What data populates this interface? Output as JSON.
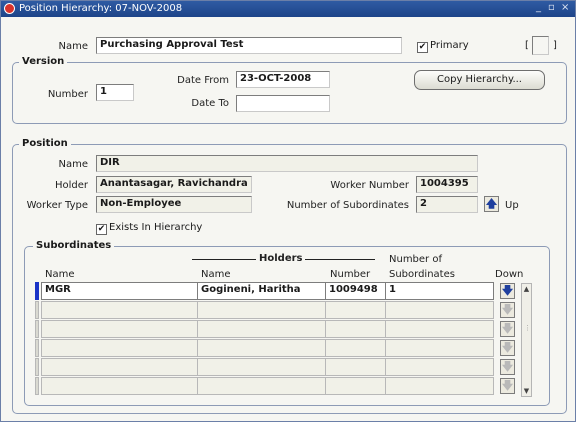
{
  "window": {
    "title": "Position Hierarchy: 07-NOV-2008",
    "controls": {
      "minimize": "_",
      "restore": "▫",
      "close": "×"
    }
  },
  "header": {
    "name_label": "Name",
    "name_value": "Purchasing Approval Test",
    "primary_label": "Primary",
    "primary_checked": true,
    "bracket_left": "[",
    "bracket_right": "]"
  },
  "version": {
    "title": "Version",
    "number_label": "Number",
    "number_value": "1",
    "date_from_label": "Date From",
    "date_from_value": "23-OCT-2008",
    "date_to_label": "Date To",
    "date_to_value": "",
    "copy_button_label": "Copy Hierarchy..."
  },
  "position": {
    "title": "Position",
    "name_label": "Name",
    "name_value": "DIR",
    "holder_label": "Holder",
    "holder_value": "Anantasagar, Ravichandra R",
    "worker_number_label": "Worker Number",
    "worker_number_value": "1004395",
    "worker_type_label": "Worker Type",
    "worker_type_value": "Non-Employee",
    "subordinates_count_label": "Number of Subordinates",
    "subordinates_count_value": "2",
    "up_label": "Up",
    "exists_label": "Exists In Hierarchy",
    "exists_checked": true
  },
  "subordinates": {
    "title": "Subordinates",
    "holders_group_label": "Holders",
    "columns": {
      "name": "Name",
      "holder_name": "Name",
      "number": "Number",
      "subordinates_line1": "Number of",
      "subordinates_line2": "Subordinates",
      "down": "Down"
    },
    "rows": [
      {
        "name": "MGR",
        "holder": "Gogineni, Haritha",
        "number": "1009498",
        "subordinates": "1"
      },
      {
        "name": "",
        "holder": "",
        "number": "",
        "subordinates": ""
      },
      {
        "name": "",
        "holder": "",
        "number": "",
        "subordinates": ""
      },
      {
        "name": "",
        "holder": "",
        "number": "",
        "subordinates": ""
      },
      {
        "name": "",
        "holder": "",
        "number": "",
        "subordinates": ""
      },
      {
        "name": "",
        "holder": "",
        "number": "",
        "subordinates": ""
      }
    ]
  },
  "icons": {
    "up_arrow": "arrow-up-icon",
    "down_arrow": "arrow-down-icon",
    "app": "oracle-icon"
  },
  "colors": {
    "titlebar": "#1d4489",
    "current_row": "#1a34c7",
    "arrow": "#1f3f9e"
  }
}
